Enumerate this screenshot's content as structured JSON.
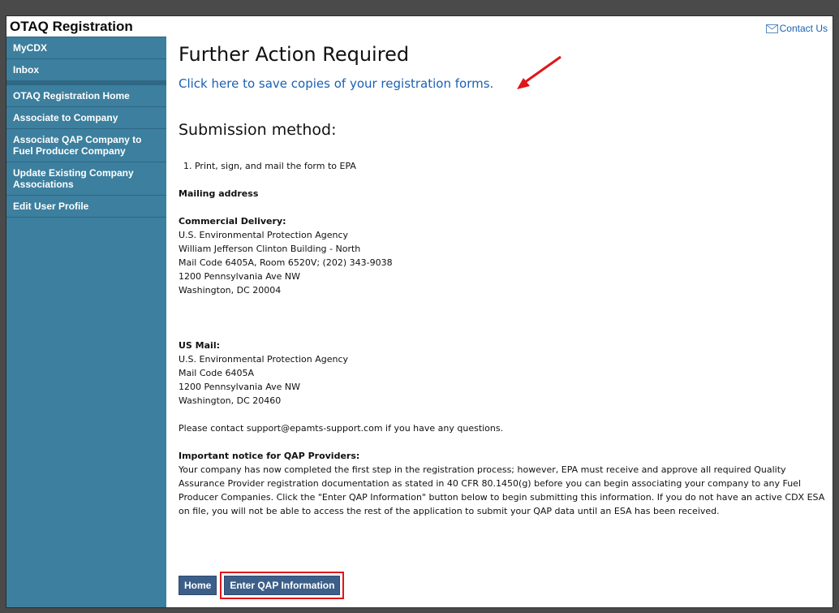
{
  "app": {
    "title": "OTAQ Registration"
  },
  "sidebar": {
    "items": [
      {
        "label": "MyCDX"
      },
      {
        "label": "Inbox"
      },
      {
        "label": "OTAQ Registration Home"
      },
      {
        "label": "Associate to Company"
      },
      {
        "label": "Associate QAP Company to Fuel Producer Company"
      },
      {
        "label": "Update Existing Company Associations"
      },
      {
        "label": "Edit User Profile"
      }
    ]
  },
  "header": {
    "contact_label": "Contact Us"
  },
  "main": {
    "title": "Further Action Required",
    "save_link": "Click here to save copies of your registration forms.",
    "submission_heading": "Submission method:",
    "step1": "1.  Print, sign, and mail the form to EPA",
    "mailing_heading": "Mailing address",
    "commercial": {
      "heading": "Commercial Delivery:",
      "lines": [
        "U.S. Environmental Protection Agency",
        "William Jefferson Clinton Building - North",
        "Mail Code 6405A, Room 6520V; (202) 343-9038",
        "1200 Pennsylvania Ave NW",
        "Washington, DC 20004"
      ]
    },
    "usmail": {
      "heading": "US Mail:",
      "lines": [
        "U.S. Environmental Protection Agency",
        "Mail Code 6405A",
        "1200 Pennsylvania Ave NW",
        "Washington, DC 20460"
      ]
    },
    "contact_text": "Please contact support@epamts-support.com if you have any questions.",
    "notice": {
      "heading": "Important notice for QAP Providers:",
      "body": "Your company has now completed the first step in the registration process; however, EPA must receive and approve all required Quality Assurance Provider registration documentation as stated in 40 CFR 80.1450(g) before you can begin associating your company to any Fuel Producer Companies. Click the \"Enter QAP Information\" button below to begin submitting this information. If you do not have an active CDX ESA on file, you will not be able to access the rest of the application to submit your QAP data until an ESA has been received."
    },
    "buttons": {
      "home": "Home",
      "enter_qap": "Enter QAP Information"
    }
  },
  "colors": {
    "sidebar": "#3c7f9e",
    "link": "#1a61b3",
    "annotation": "#e0161a",
    "button": "#3c5f8a"
  }
}
